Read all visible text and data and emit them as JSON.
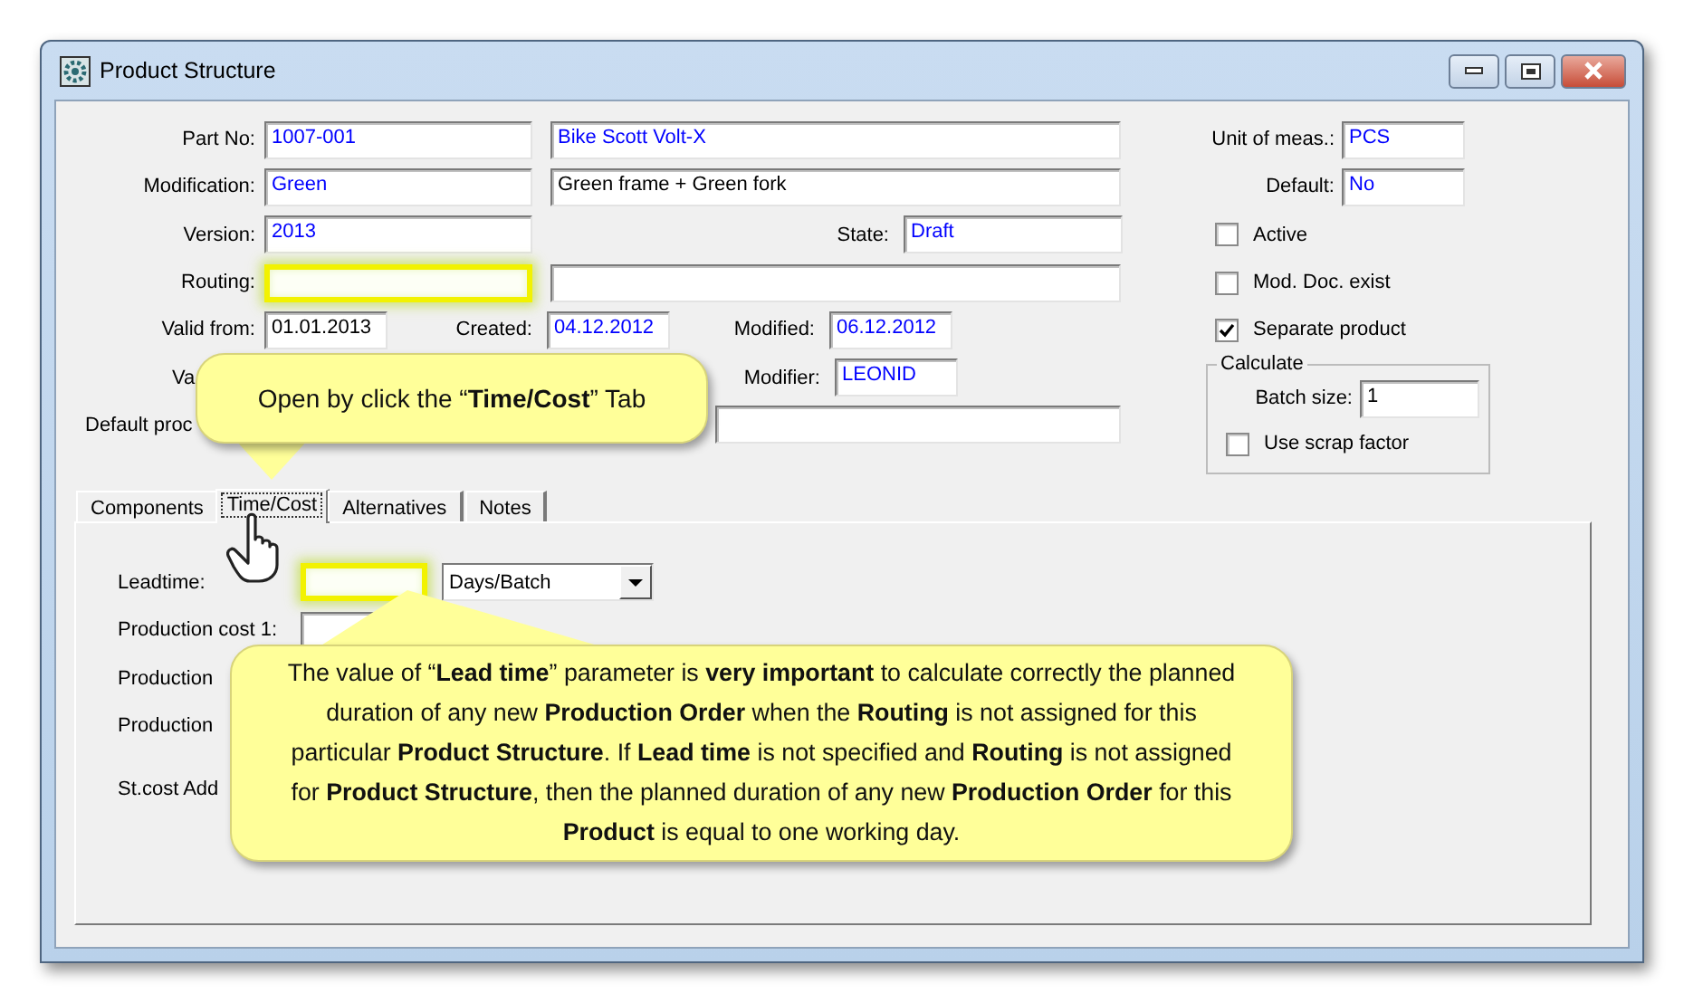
{
  "window": {
    "title": "Product Structure"
  },
  "form_rows": [
    {
      "items": [
        {
          "kind": "label",
          "text": "Part No:"
        },
        {
          "kind": "field",
          "value": "1007-001",
          "color": "#0000ff",
          "highlighted": false
        },
        {
          "kind": "wide_field",
          "value": "Bike Scott Volt-X",
          "color": "#0000ff",
          "highlighted": false
        }
      ]
    },
    {
      "items": [
        {
          "kind": "label",
          "text": "Modification:"
        },
        {
          "kind": "field",
          "value": "Green",
          "color": "#0000ff",
          "highlighted": false
        },
        {
          "kind": "wide_field",
          "value": "Green frame + Green fork",
          "color": "#000000",
          "highlighted": false
        }
      ]
    },
    {
      "items": [
        {
          "kind": "label",
          "text": "Version:"
        },
        {
          "kind": "field",
          "value": "2013",
          "color": "#0000ff",
          "highlighted": false
        },
        {
          "kind": "state_label",
          "text": "State:"
        },
        {
          "kind": "state_field",
          "value": "Draft",
          "color": "#0000ff",
          "highlighted": false
        }
      ]
    },
    {
      "items": [
        {
          "kind": "label",
          "text": "Routing:"
        },
        {
          "kind": "field",
          "highlighted": true
        },
        {
          "kind": "wide_field",
          "highlighted": false
        }
      ]
    },
    {
      "items": [
        {
          "kind": "label",
          "text": "Valid from:"
        },
        {
          "kind": "date_field",
          "value": "01.01.2013",
          "color": "#000000",
          "highlighted": false
        },
        {
          "kind": "mid_label",
          "text": "Created:"
        },
        {
          "kind": "date_field",
          "value": "04.12.2012",
          "color": "#0000ff",
          "highlighted": false
        },
        {
          "kind": "mid_label",
          "text": "Modified:"
        },
        {
          "kind": "date_field",
          "value": "06.12.2012",
          "color": "#0000ff",
          "highlighted": false
        }
      ]
    },
    {
      "items": [
        {
          "kind": "cut_label",
          "text": "Va"
        },
        {
          "kind": "far_label",
          "text": "Modifier:"
        },
        {
          "kind": "date_field",
          "value": "LEONID",
          "color": "#0000ff",
          "highlighted": false
        }
      ]
    },
    {
      "items": [
        {
          "kind": "cut_long_label",
          "text": "Default proc"
        },
        {
          "kind": "far_wide_field",
          "highlighted": false
        }
      ]
    }
  ],
  "right_column": [
    {
      "kind": "field",
      "label": "Unit of meas.:",
      "value": "PCS",
      "color": "#0000ff"
    },
    {
      "kind": "field",
      "label": "Default:",
      "value": "No",
      "color": "#0000ff"
    },
    {
      "kind": "checkbox",
      "label": "Active",
      "checked": false
    },
    {
      "kind": "checkbox",
      "label": "Mod. Doc. exist",
      "checked": false
    },
    {
      "kind": "checkbox",
      "label": "Separate product",
      "checked": true
    },
    {
      "kind": "group",
      "title": "Calculate",
      "items": [
        {
          "kind": "field",
          "label": "Batch size:",
          "value": "1",
          "color": "#000000"
        },
        {
          "kind": "checkbox",
          "label": "Use scrap factor",
          "checked": false
        }
      ]
    }
  ],
  "tabs": [
    {
      "label": "Components",
      "selected": false
    },
    {
      "label": "Time/Cost",
      "selected": true
    },
    {
      "label": "Alternatives",
      "selected": false
    },
    {
      "label": "Notes",
      "selected": false
    }
  ],
  "time_cost": {
    "rows": [
      {
        "label": "Leadtime:",
        "field": {
          "highlighted": true
        },
        "unit": {
          "value": "Days/Batch"
        }
      },
      {
        "label": "Production cost 1:",
        "field": {
          "highlighted": false
        }
      },
      {
        "label": "Production"
      },
      {
        "label": "Production"
      },
      {
        "label": "St.cost Add"
      }
    ]
  },
  "callouts": [
    {
      "text": "Open by click the “**Time/Cost**” Tab"
    },
    {
      "text": "The value of “**Lead time**” parameter is **very important** to calculate correctly the planned duration of any new **Production Order** when the **Routing** is not assigned for this particular **Product Structure**.  If **Lead time** is not specified and **Routing** is not assigned for **Product Structure**, then the planned duration of any new **Production Order** for this **Product** is equal to one working day."
    }
  ]
}
